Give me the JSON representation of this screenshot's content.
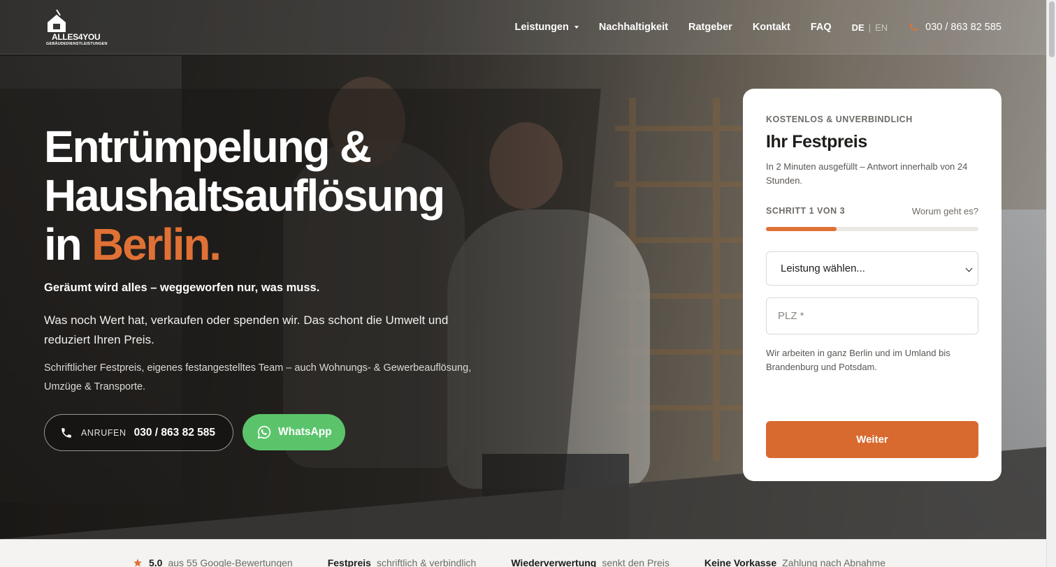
{
  "brand": {
    "name": "ALLES4YOU",
    "tagline": "GEBÄUDEDIENSTLEISTUNGEN"
  },
  "nav": {
    "items": [
      "Leistungen",
      "Nachhaltigkeit",
      "Ratgeber",
      "Kontakt",
      "FAQ"
    ],
    "lang_active": "DE",
    "lang_separator": "|",
    "lang_other": "EN",
    "phone": "030 / 863 82 585"
  },
  "hero": {
    "title_line1": "Entrümpelung &",
    "title_line2": "Haushaltsauflösung",
    "title_line3_prefix": "in ",
    "title_line3_accent": "Berlin.",
    "lead": "Geräumt wird alles – weggeworfen nur, was muss.",
    "paragraph1": "Was noch Wert hat, verkaufen oder spenden wir. Das schont die Umwelt und reduziert Ihren Preis.",
    "paragraph2": "Schriftlicher Festpreis, eigenes festangestelltes Team – auch Wohnungs- & Gewerbeauflösung, Umzüge & Transporte.",
    "call_label": "ANRUFEN",
    "call_number": "030 / 863 82 585",
    "whatsapp_label": "WhatsApp"
  },
  "form": {
    "eyebrow": "KOSTENLOS & UNVERBINDLICH",
    "title": "Ihr Festpreis",
    "subtitle": "In 2 Minuten ausgefüllt – Antwort innerhalb von 24 Stunden.",
    "step_label": "SCHRITT 1 VON 3",
    "step_question": "Worum geht es?",
    "progress_fraction": 0.333,
    "select_value": "Leistung wählen...",
    "plz_placeholder": "PLZ *",
    "note": "Wir arbeiten in ganz Berlin und im Umland bis Brandenburg und Potsdam.",
    "submit_label": "Weiter"
  },
  "trust": [
    {
      "strong": "5.0",
      "text": "aus 55 Google-Bewertungen",
      "icon": "star-icon"
    },
    {
      "strong": "Festpreis",
      "text": "schriftlich & verbindlich"
    },
    {
      "strong": "Wiederverwertung",
      "text": "senkt den Preis"
    },
    {
      "strong": "Keine Vorkasse",
      "text": "Zahlung nach Abnahme"
    }
  ],
  "colors": {
    "accent": "#e07136",
    "button": "#d86a30",
    "whatsapp": "#5bc46b"
  }
}
